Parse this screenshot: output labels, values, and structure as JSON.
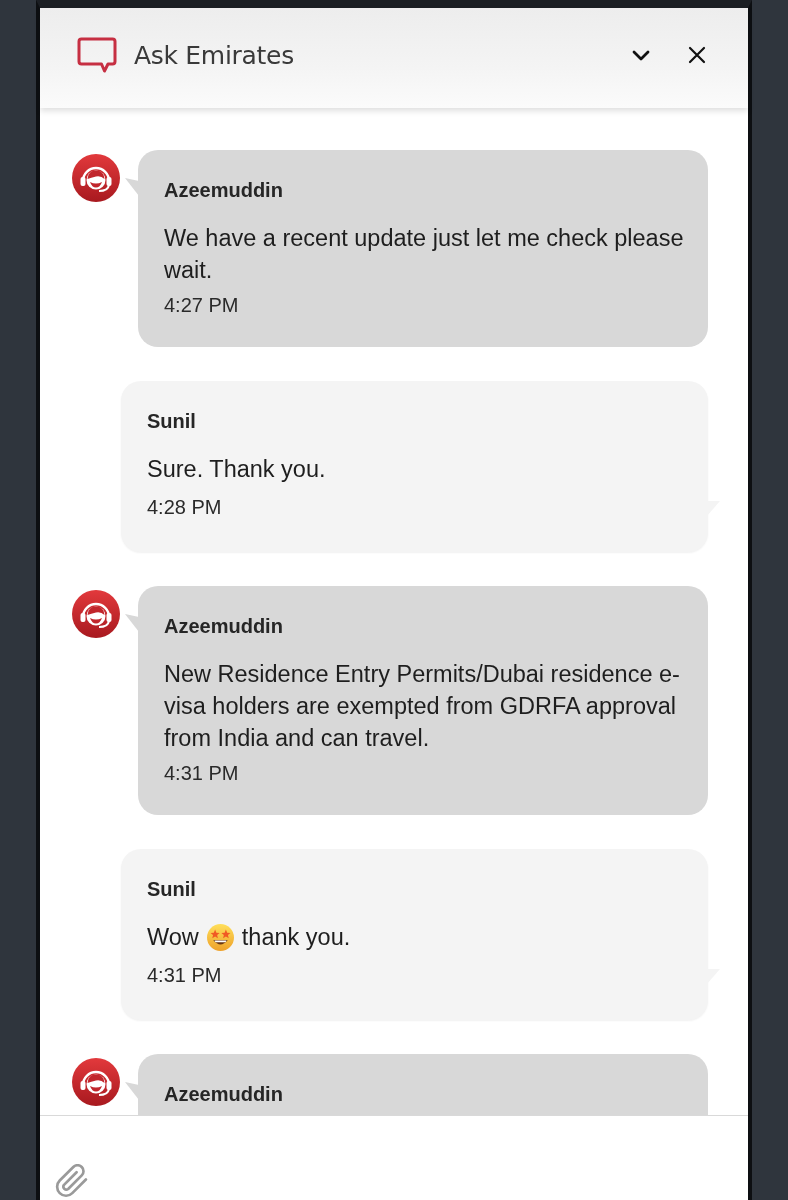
{
  "header": {
    "title": "Ask Emirates"
  },
  "messages": [
    {
      "kind": "agent",
      "name": "Azeemuddin",
      "text": "We have a recent update just let me check please wait.",
      "time": "4:27 PM"
    },
    {
      "kind": "user",
      "name": "Sunil",
      "text": "Sure. Thank you.",
      "time": "4:28 PM"
    },
    {
      "kind": "agent",
      "name": "Azeemuddin",
      "text": "New Residence Entry Permits/Dubai residence e-visa holders are exempted from GDRFA approval from India and can travel.",
      "time": "4:31 PM"
    },
    {
      "kind": "user",
      "name": "Sunil",
      "parts": [
        {
          "kind": "text",
          "text": "Wow"
        },
        {
          "kind": "emoji"
        },
        {
          "kind": "text",
          "text": "thank you."
        }
      ],
      "time": "4:31 PM"
    },
    {
      "kind": "agent",
      "name": "Azeemuddin"
    }
  ]
}
